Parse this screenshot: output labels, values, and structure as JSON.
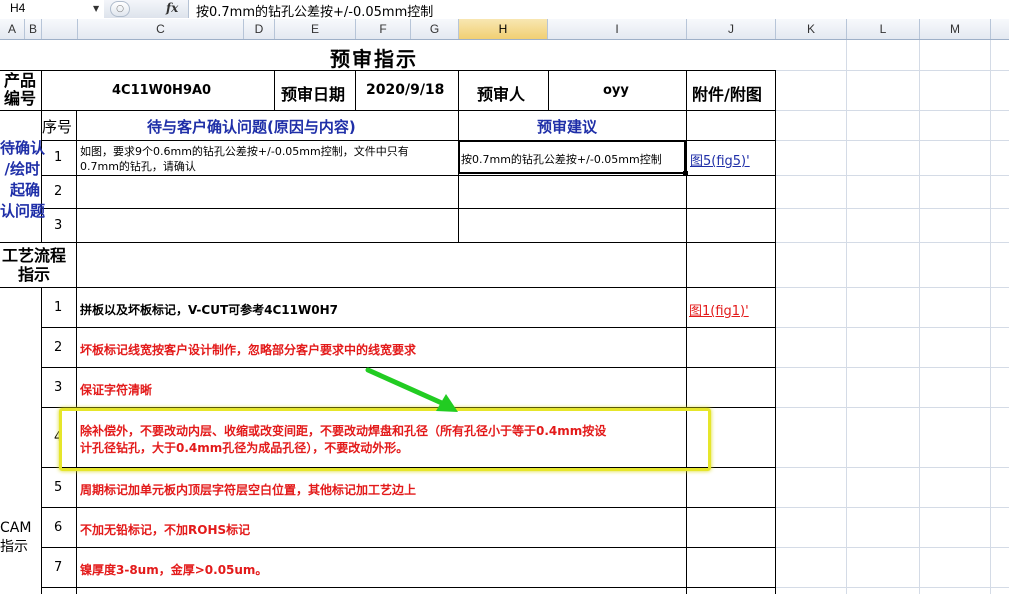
{
  "formula_bar": {
    "name_box": "H4",
    "formula": "按0.7mm的钻孔公差按+/-0.05mm控制"
  },
  "columns": [
    "A",
    "B",
    "C",
    "D",
    "E",
    "F",
    "G",
    "H",
    "I",
    "J",
    "K",
    "L",
    "M"
  ],
  "sheet": {
    "title": "预审指示",
    "product_label": "产品\n编号",
    "product_value": "4C11W0H9A0",
    "review_date_label": "预审日期",
    "review_date_value": "2020/9/18",
    "reviewer_label": "预审人",
    "reviewer_value": "oyy",
    "attachment_label": "附件/附图",
    "q_section_label": "待确认\n/绘时\n起确\n认问题",
    "seq_header": "序号",
    "issue_header": "待与客户确认问题(原因与内容)",
    "suggest_header": "预审建议",
    "issues": [
      {
        "no": "1",
        "text_line1": "如图，要求9个0.6mm的钻孔公差按+/-0.05mm控制，文件中只有",
        "text_line2": "0.7mm的钻孔，请确认",
        "suggest": "按0.7mm的钻孔公差按+/-0.05mm控制",
        "attach": "图5(fig5)'"
      },
      {
        "no": "2"
      },
      {
        "no": "3"
      }
    ],
    "process_label": "工艺流程\n指示",
    "cam_label": "CAM\n指示",
    "cam_items": [
      {
        "no": "1",
        "text": "拼板以及坏板标记，V-CUT可参考4C11W0H7",
        "color": "black",
        "attach": "图1(fig1)'"
      },
      {
        "no": "2",
        "text": "坏板标记线宽按客户设计制作，忽略部分客户要求中的线宽要求",
        "color": "red"
      },
      {
        "no": "3",
        "text": "保证字符清晰",
        "color": "red"
      },
      {
        "no": "4",
        "text_line1": "除补偿外，不要改动内层、收缩或改变间距，不要改动焊盘和孔径（所有孔径小于等于0.4mm按设",
        "text_line2": "计孔径钻孔，大于0.4mm孔径为成品孔径），不要改动外形。",
        "color": "red"
      },
      {
        "no": "5",
        "text": "周期标记加单元板内顶层字符层空白位置，其他标记加工艺边上",
        "color": "red"
      },
      {
        "no": "6",
        "text": "不加无铅标记，不加ROHS标记",
        "color": "red"
      },
      {
        "no": "7",
        "text": "镍厚度3-8um，金厚>0.05um。",
        "color": "red"
      }
    ]
  },
  "colors": {
    "blue_text": "#1f2fa8",
    "red_text": "#e31a1a",
    "highlight_box": "#e6e62a",
    "arrow": "#22cc22",
    "selected_col": "#f1cf73"
  }
}
